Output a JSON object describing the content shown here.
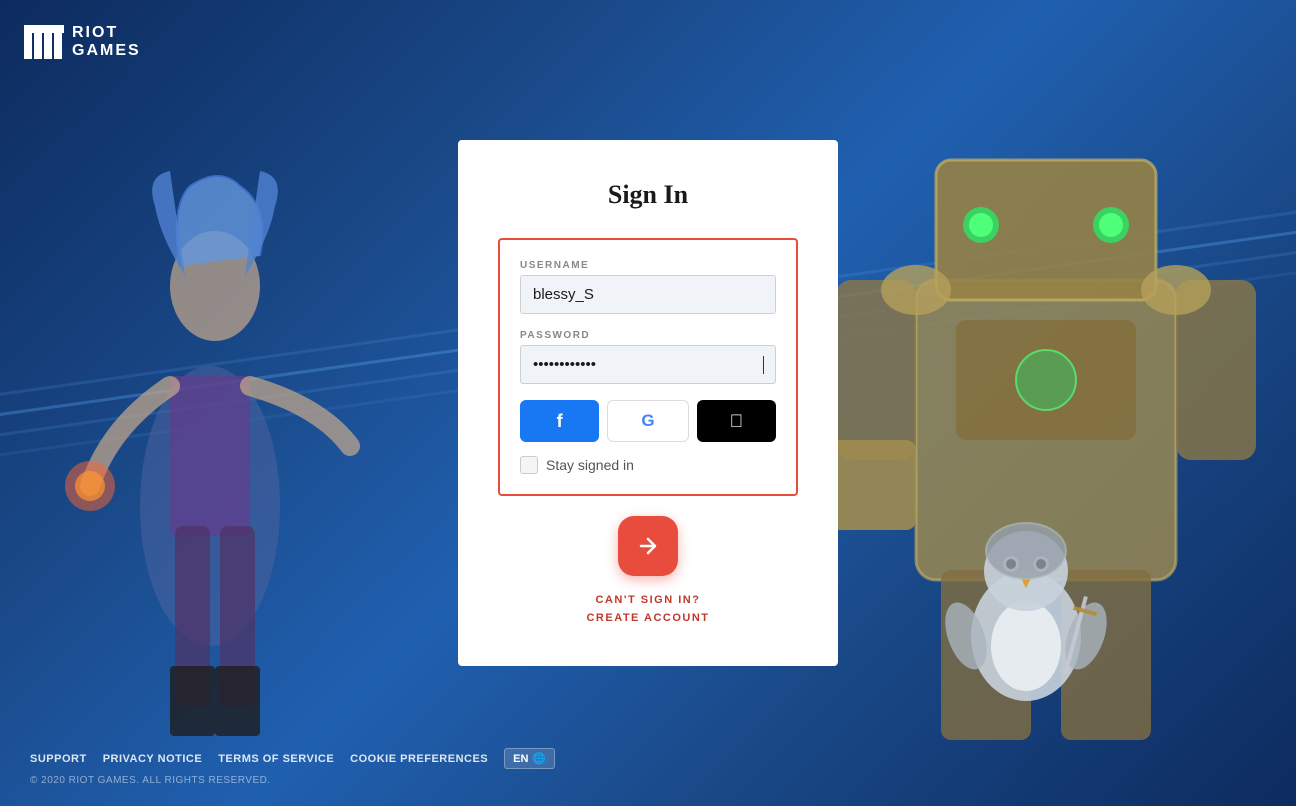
{
  "brand": {
    "name_line1": "RIOT",
    "name_line2": "GAMES"
  },
  "modal": {
    "title": "Sign In",
    "username_label": "USERNAME",
    "username_value": "blessy_S",
    "password_label": "PASSWORD",
    "password_value": "••••••••••••",
    "stay_signed_label": "Stay signed in",
    "cant_sign_in": "CAN'T SIGN IN?",
    "create_account": "CREATE ACCOUNT"
  },
  "social": {
    "facebook_label": "f",
    "google_label": "G",
    "apple_label": ""
  },
  "footer": {
    "support": "SUPPORT",
    "privacy": "PRIVACY NOTICE",
    "terms": "TERMS OF SERVICE",
    "cookie": "COOKIE PREFERENCES",
    "lang": "EN",
    "copyright": "© 2020 RIOT GAMES. ALL RIGHTS RESERVED."
  }
}
